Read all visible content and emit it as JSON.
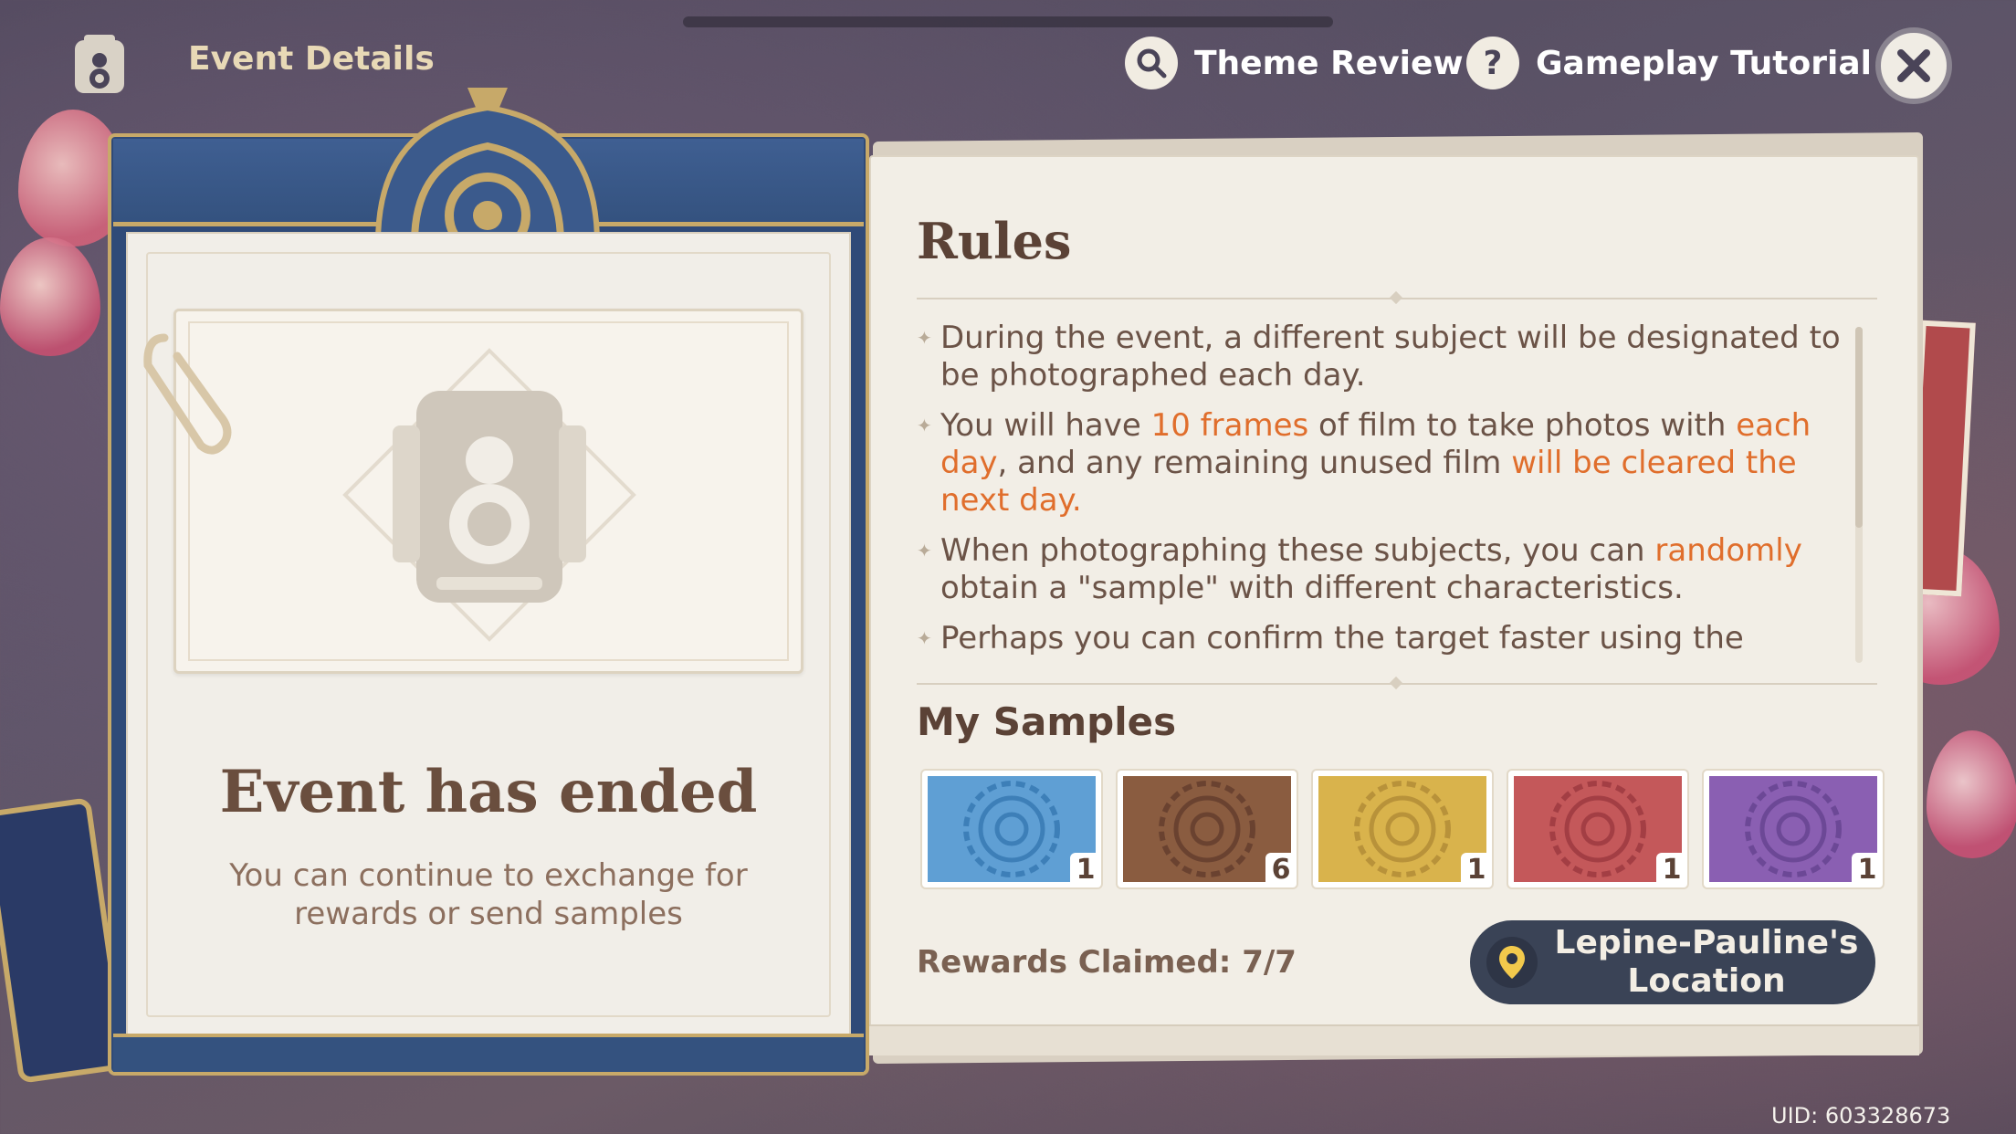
{
  "header": {
    "title": "Event Details",
    "theme_review": "Theme Review",
    "gameplay_tutorial": "Gameplay Tutorial"
  },
  "card": {
    "status_title": "Event has ended",
    "status_subtitle": "You can continue to exchange for rewards or send samples"
  },
  "rules": {
    "title": "Rules",
    "items": [
      {
        "segments": [
          {
            "text": "During the event, a different subject will be designated to be photographed each day.",
            "highlight": false
          }
        ]
      },
      {
        "segments": [
          {
            "text": "You will have ",
            "highlight": false
          },
          {
            "text": "10 frames",
            "highlight": true
          },
          {
            "text": " of film to take photos with ",
            "highlight": false
          },
          {
            "text": "each day",
            "highlight": true
          },
          {
            "text": ", and any remaining unused film ",
            "highlight": false
          },
          {
            "text": "will be cleared the next day.",
            "highlight": true
          }
        ]
      },
      {
        "segments": [
          {
            "text": "When photographing these subjects, you can ",
            "highlight": false
          },
          {
            "text": "randomly",
            "highlight": true
          },
          {
            "text": " obtain a \"sample\" with different characteristics.",
            "highlight": false
          }
        ]
      },
      {
        "segments": [
          {
            "text": "Perhaps you can confirm the target faster using the",
            "highlight": false
          }
        ]
      }
    ]
  },
  "samples": {
    "title": "My Samples",
    "items": [
      {
        "color": "#5f9fd4",
        "ring": "#3d7fb8",
        "count": "1"
      },
      {
        "color": "#8a5c40",
        "ring": "#6a4230",
        "count": "6"
      },
      {
        "color": "#d9b34c",
        "ring": "#b8923a",
        "count": "1"
      },
      {
        "color": "#c4585a",
        "ring": "#a33e44",
        "count": "1"
      },
      {
        "color": "#8a5fb2",
        "ring": "#6c4896",
        "count": "1"
      }
    ]
  },
  "rewards_claimed": "Rewards Claimed: 7/7",
  "location_button": "Lepine-Pauline's Location",
  "uid": "UID: 603328673",
  "colors": {
    "highlight": "#e06e2c",
    "card_blue": "#2f4a78",
    "gold": "#c7a969"
  }
}
